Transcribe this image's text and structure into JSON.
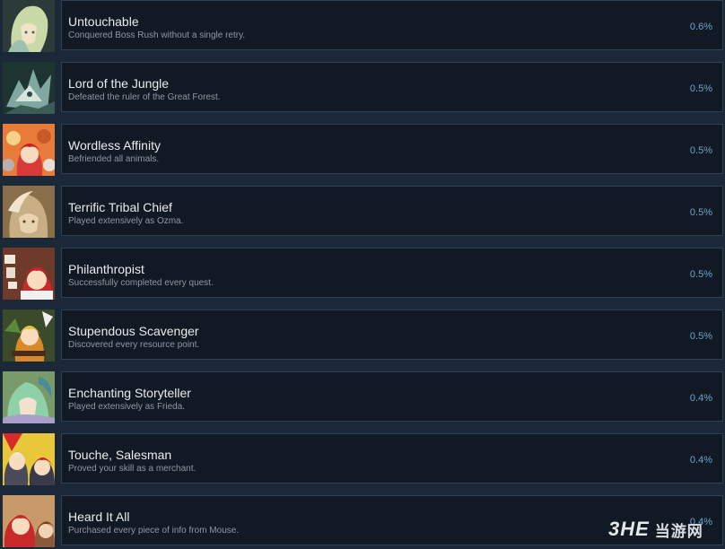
{
  "achievements": [
    {
      "title": "Untouchable",
      "description": "Conquered Boss Rush without a single retry.",
      "percent": "0.6%",
      "icon": "green-haired-character-icon"
    },
    {
      "title": "Lord of the Jungle",
      "description": "Defeated the ruler of the Great Forest.",
      "percent": "0.5%",
      "icon": "forest-beast-icon"
    },
    {
      "title": "Wordless Affinity",
      "description": "Befriended all animals.",
      "percent": "0.5%",
      "icon": "hero-with-animals-icon"
    },
    {
      "title": "Terrific Tribal Chief",
      "description": "Played extensively as Ozma.",
      "percent": "0.5%",
      "icon": "ozma-icon"
    },
    {
      "title": "Philanthropist",
      "description": "Successfully completed every quest.",
      "percent": "0.5%",
      "icon": "quest-board-icon"
    },
    {
      "title": "Stupendous Scavenger",
      "description": "Discovered every resource point.",
      "percent": "0.5%",
      "icon": "scavenger-icon"
    },
    {
      "title": "Enchanting Storyteller",
      "description": "Played extensively as Frieda.",
      "percent": "0.4%",
      "icon": "frieda-icon"
    },
    {
      "title": "Touche, Salesman",
      "description": "Proved your skill as a merchant.",
      "percent": "0.4%",
      "icon": "merchant-icon"
    },
    {
      "title": "Heard It All",
      "description": "Purchased every piece of info from Mouse.",
      "percent": "0.4%",
      "icon": "mouse-info-icon"
    }
  ],
  "watermark": {
    "logo": "3HE",
    "text": "当游网"
  },
  "colors": {
    "background": "#1b2838",
    "card": "#111925",
    "border": "#2f4154",
    "percent": "#6ba5c9"
  }
}
